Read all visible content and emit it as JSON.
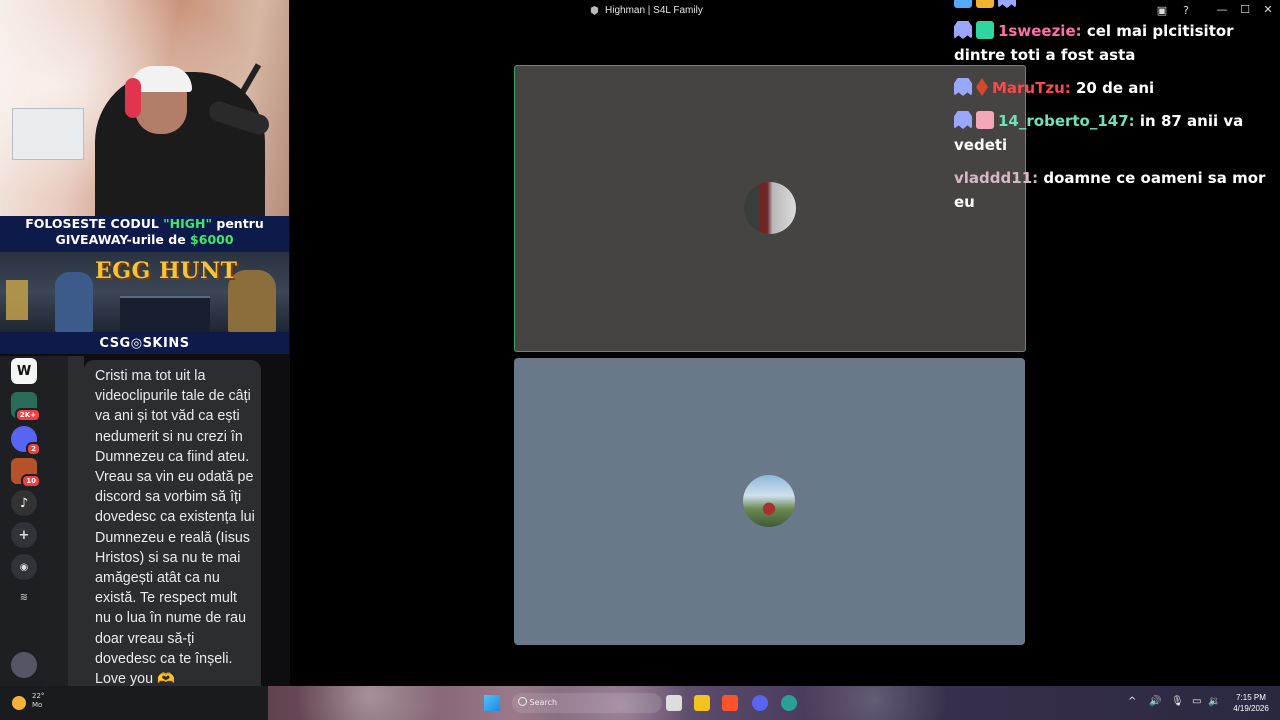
{
  "window": {
    "title": "Highman | S4L Family",
    "controls": {
      "minimize": "—",
      "maximize": "☐",
      "close": "✕"
    }
  },
  "overlay": {
    "promo_line1_white": "FOLOSESTE CODUL ",
    "promo_code": "\"HIGH\"",
    "promo_line1_end": " pentru",
    "promo_line2_white": "GIVEAWAY-urile de ",
    "promo_amount": "$6000",
    "egg_hunt": "EGG HUNT",
    "sponsor": "CSG◎SKINS"
  },
  "server_strip": {
    "items": [
      {
        "icon": "w-server-icon",
        "label": "W"
      },
      {
        "icon": "grid-server-icon",
        "badge": "2K+"
      },
      {
        "icon": "chat-server-icon",
        "badge": "2"
      },
      {
        "icon": "star-server-icon",
        "badge": "10"
      },
      {
        "icon": "music-server-icon",
        "label": "♪"
      },
      {
        "icon": "add-server-icon",
        "label": "+"
      },
      {
        "icon": "explore-icon",
        "label": "◉"
      }
    ]
  },
  "dm_message": {
    "text": "Cristi ma tot uit la videoclipurile tale de câți va ani și tot văd ca ești nedumerit si nu crezi în Dumnezeu ca fiind ateu. Vreau sa vin eu odată pe discord sa vorbim să îți dovedesc ca existența lui Dumnezeu e reală (Iisus Hristos) si sa nu te mai amăgești atât ca nu există. Te respect mult nu o lua în nume de rau doar vreau să-ți dovedesc ca te înșeli. Love you 🫶"
  },
  "call": {
    "tiles": [
      {
        "name": "participant-1",
        "speaking": true,
        "color": "#454442"
      },
      {
        "name": "participant-2",
        "speaking": false,
        "color": "#69798a"
      }
    ]
  },
  "twitch_chat": {
    "messages": [
      {
        "user": "1sweezie:",
        "text": "cel mai plcitisitor dintre toti a fost asta",
        "color": "#ff6ea8"
      },
      {
        "user": "MaruTzu:",
        "text": "20 de ani",
        "color": "#ff4848"
      },
      {
        "user": "14_roberto_147:",
        "text": "in 87 anii va vedeti",
        "color": "#6fe0b7"
      },
      {
        "user": "vladdd11:",
        "text": "doamne ce oameni sa mor eu",
        "color": "#d5b8c5"
      }
    ]
  },
  "taskbar": {
    "weather_temp": "22°",
    "weather_label": "Mo",
    "search_placeholder": "Search",
    "time": "7:15 PM",
    "date": "4/19/2026"
  }
}
